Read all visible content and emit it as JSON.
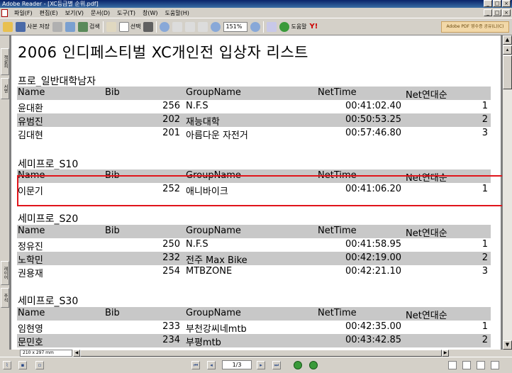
{
  "window": {
    "title": "Adobe Reader - [XC등급별 순위.pdf]",
    "min_label": "_",
    "max_label": "□",
    "close_label": "×"
  },
  "menu": [
    "파일(F)",
    "편집(E)",
    "보기(V)",
    "문서(D)",
    "도구(T)",
    "창(W)",
    "도움말(H)"
  ],
  "toolbar": {
    "save_copy": "사본 저장",
    "search": "검색",
    "select": "선택",
    "zoom": "151%",
    "help": "도움말",
    "yahoo": "Y!",
    "ad": "Adobe PDF 영수증 공유(L)(C)"
  },
  "left_tabs": [
    "책갈피",
    "서명",
    "레이어",
    "주석"
  ],
  "document": {
    "title": "2006 인디페스티벌 XC개인전 입상자 리스트",
    "columns": [
      "Name",
      "Bib",
      "GroupName",
      "NetTime",
      "Net연대순"
    ],
    "sections": [
      {
        "name": "프로_일반대학남자",
        "rows": [
          {
            "name": "윤대환",
            "bib": "256",
            "group": "N.F.S",
            "time": "00:41:02.40",
            "rank": "1"
          },
          {
            "name": "유범진",
            "bib": "202",
            "group": "재능대학",
            "time": "00:50:53.25",
            "rank": "2"
          },
          {
            "name": "김대현",
            "bib": "201",
            "group": "아름다운 자전거",
            "time": "00:57:46.80",
            "rank": "3"
          }
        ]
      },
      {
        "name": "세미프로_S10",
        "rows": [
          {
            "name": "이문기",
            "bib": "252",
            "group": "애니바이크",
            "time": "00:41:06.20",
            "rank": "1"
          }
        ]
      },
      {
        "name": "세미프로_S20",
        "rows": [
          {
            "name": "정유진",
            "bib": "250",
            "group": "N.F.S",
            "time": "00:41:58.95",
            "rank": "1"
          },
          {
            "name": "노학민",
            "bib": "232",
            "group": "전주 Max Bike",
            "time": "00:42:19.00",
            "rank": "2"
          },
          {
            "name": "권용재",
            "bib": "254",
            "group": "MTBZONE",
            "time": "00:42:21.10",
            "rank": "3"
          }
        ]
      },
      {
        "name": "세미프로_S30",
        "rows": [
          {
            "name": "임현영",
            "bib": "233",
            "group": "부천강씨네mtb",
            "time": "00:42:35.00",
            "rank": "1"
          },
          {
            "name": "문민호",
            "bib": "234",
            "group": "부평mtb",
            "time": "00:43:42.85",
            "rank": "2"
          }
        ]
      }
    ]
  },
  "status": {
    "page_size": "210 x 297 mm",
    "page": "1/3"
  },
  "colors": {
    "highlight": "#e0151b",
    "header_row": "#c8c8c8"
  }
}
